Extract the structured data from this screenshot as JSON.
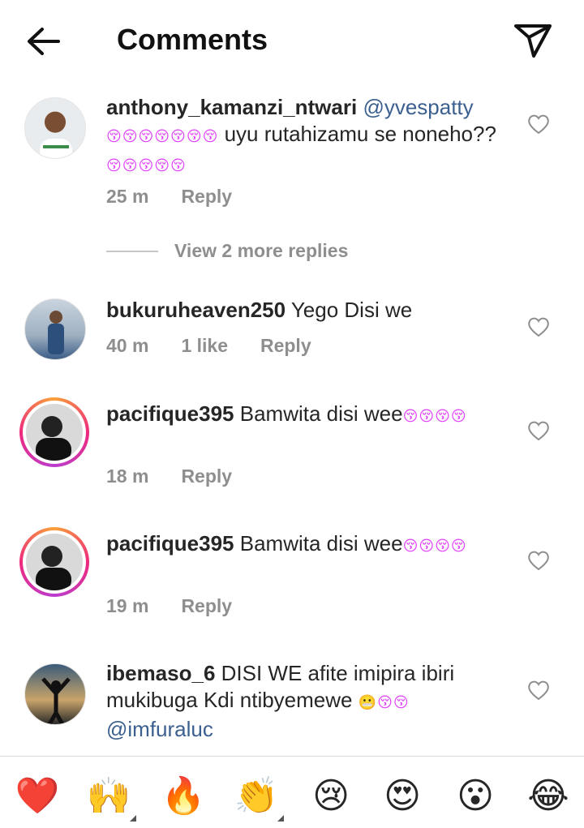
{
  "header": {
    "title": "Comments",
    "back_icon": "arrow-left-icon",
    "share_icon": "paper-plane-icon"
  },
  "comments": [
    {
      "username": "anthony_kamanzi_ntwari",
      "mention": "@yvespatty",
      "emojis_a": "😚😚😚😚😚😚😚",
      "text_a": " uyu rutahizamu se noneho??",
      "emojis_b": "😚😚😚😚😚",
      "time": "25 m",
      "reply": "Reply"
    },
    {
      "username": "bukuruheaven250",
      "text_a": " Yego Disi  we",
      "time": "40 m",
      "likes": "1 like",
      "reply": "Reply"
    },
    {
      "username": "pacifique395",
      "text_a": " Bamwita disi wee",
      "emojis_a": "😚😚😚😚",
      "time": "18 m",
      "reply": "Reply"
    },
    {
      "username": "pacifique395",
      "text_a": " Bamwita disi wee",
      "emojis_a": "😚😚😚😚",
      "time": "19 m",
      "reply": "Reply"
    },
    {
      "username": "ibemaso_6",
      "text_a": " DISI WE afite imipira ibiri mukibuga Kdi ntibyemewe ",
      "emojis_a": "😬😚😚",
      "mention": "@imfuraluc"
    }
  ],
  "view_more": "View 2 more replies",
  "reactions": [
    {
      "icon": "red-heart-icon",
      "glyph": "❤️"
    },
    {
      "icon": "raising-hands-icon",
      "glyph": "🙌"
    },
    {
      "icon": "fire-icon",
      "glyph": "🔥"
    },
    {
      "icon": "clapping-hands-icon",
      "glyph": "👏"
    },
    {
      "icon": "crying-face-icon",
      "glyph": "😢"
    },
    {
      "icon": "heart-eyes-icon",
      "glyph": "😍"
    },
    {
      "icon": "surprised-face-icon",
      "glyph": "😮"
    },
    {
      "icon": "laughing-face-icon",
      "glyph": "😂"
    }
  ],
  "colors": {
    "accent_link": "#3b5f8f",
    "meta_gray": "#8e8e8e",
    "text": "#262626"
  }
}
